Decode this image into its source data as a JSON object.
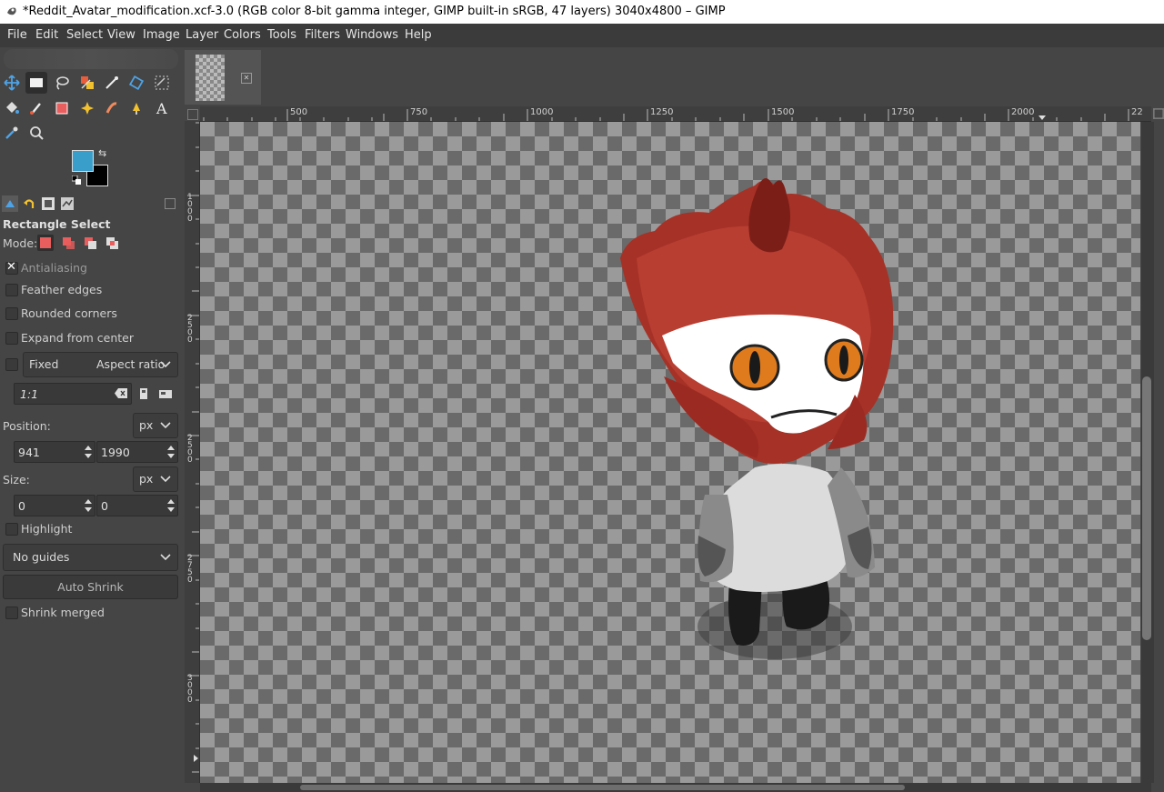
{
  "window": {
    "title": "*Reddit_Avatar_modification.xcf-3.0 (RGB color 8-bit gamma integer, GIMP built-in sRGB, 47 layers) 3040x4800 – GIMP"
  },
  "menubar": [
    "File",
    "Edit",
    "Select",
    "View",
    "Image",
    "Layer",
    "Colors",
    "Tools",
    "Filters",
    "Windows",
    "Help"
  ],
  "colors": {
    "foreground": "#3a9ecb",
    "background": "#000000"
  },
  "tool_options": {
    "title": "Rectangle Select",
    "mode_label": "Mode:",
    "antialiasing": {
      "label": "Antialiasing",
      "checked": true
    },
    "feather_edges": {
      "label": "Feather edges",
      "checked": false
    },
    "rounded_corners": {
      "label": "Rounded corners",
      "checked": false
    },
    "expand_from_center": {
      "label": "Expand from center",
      "checked": false
    },
    "fixed": {
      "label": "Fixed",
      "option": "Aspect ratio",
      "checked": false
    },
    "ratio_value": "1:1",
    "position": {
      "label": "Position:",
      "unit": "px",
      "x": "941",
      "y": "1990"
    },
    "size": {
      "label": "Size:",
      "unit": "px",
      "w": "0",
      "h": "0"
    },
    "highlight": {
      "label": "Highlight",
      "checked": false
    },
    "guides": "No guides",
    "auto_shrink": "Auto Shrink",
    "shrink_merged": {
      "label": "Shrink merged",
      "checked": false
    }
  },
  "rulers": {
    "horizontal": [
      "500",
      "750",
      "1000",
      "1250",
      "1500",
      "1750",
      "2000",
      "22"
    ],
    "vertical": [
      "1000",
      "2500",
      "2500",
      "2750",
      "3000"
    ]
  },
  "icons": {
    "toolbox": [
      "move-icon",
      "rect-select-icon",
      "lasso-icon",
      "fuzzy-select-icon",
      "paths-icon",
      "transform-icon",
      "warp-icon",
      "bucket-fill-icon",
      "paintbrush-icon",
      "eraser-icon",
      "heal-icon",
      "smudge-icon",
      "dodge-icon",
      "text-icon",
      "color-picker-icon",
      "zoom-icon"
    ]
  }
}
